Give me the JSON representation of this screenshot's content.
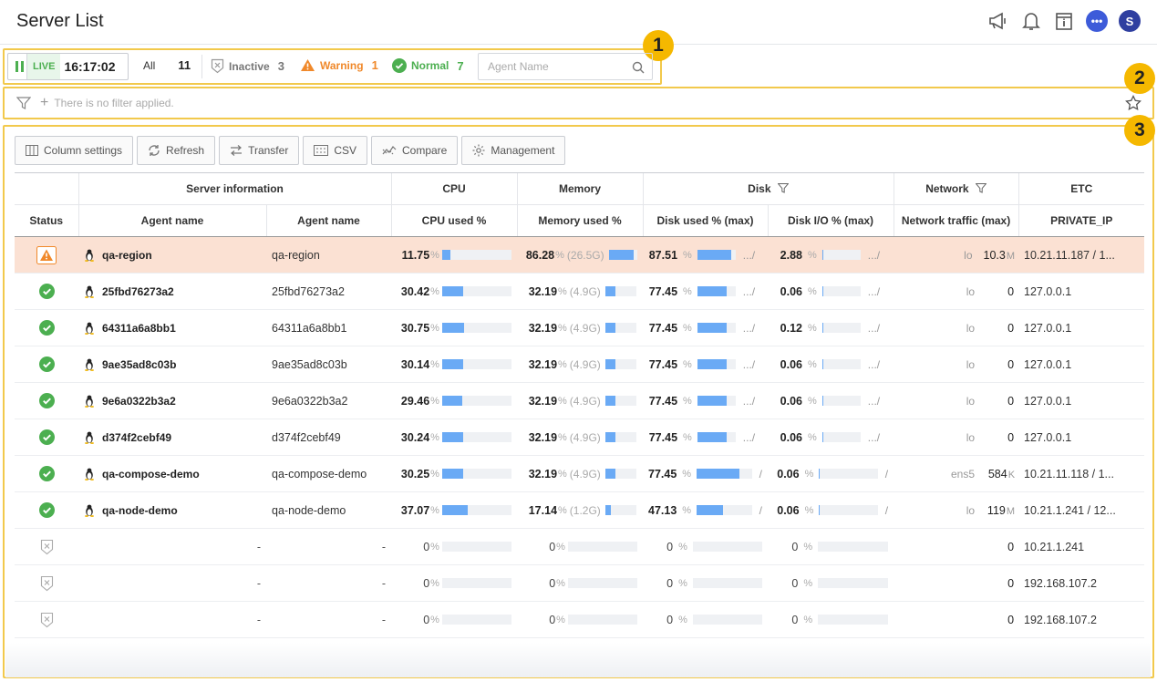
{
  "header": {
    "title": "Server List",
    "icons": [
      "megaphone-icon",
      "bell-icon",
      "document-info-icon",
      "chat-icon",
      "avatar"
    ],
    "avatar_letter": "S",
    "chat_glyph": "•••"
  },
  "badges": [
    "1",
    "2",
    "3"
  ],
  "status_bar": {
    "live_label": "LIVE",
    "time": "16:17:02",
    "all_label": "All",
    "all_count": "11",
    "inactive_label": "Inactive",
    "inactive_count": "3",
    "warning_label": "Warning",
    "warning_count": "1",
    "normal_label": "Normal",
    "normal_count": "7",
    "search_placeholder": "Agent Name"
  },
  "filter": {
    "text": "There is no filter applied."
  },
  "toolbar": {
    "column_settings": "Column settings",
    "refresh": "Refresh",
    "transfer": "Transfer",
    "csv": "CSV",
    "compare": "Compare",
    "management": "Management"
  },
  "table": {
    "groups": [
      "Server information",
      "CPU",
      "Memory",
      "Disk",
      "Network",
      "ETC"
    ],
    "columns": [
      "Status",
      "Agent name",
      "Agent name",
      "CPU used %",
      "Memory used %",
      "Disk used % (max)",
      "Disk I/O % (max)",
      "Network traffic (max)",
      "PRIVATE_IP"
    ],
    "pct": "%",
    "ellipsis": ".../",
    "slash": "/",
    "dash": "-",
    "rows": [
      {
        "status": "warning",
        "name": "qa-region",
        "name2": "qa-region",
        "cpu": "11.75",
        "cpu_fill": 0.12,
        "mem": "86.28",
        "mem_size": "(26.5G)",
        "mem_fill": 0.86,
        "disk": "87.51",
        "disk_fill": 0.88,
        "disk_tail": ".../",
        "io": "2.88",
        "io_fill": 0.03,
        "io_tail": ".../",
        "iface": "lo",
        "net": "10.3",
        "net_unit": "M",
        "ip": "10.21.11.187 / 1..."
      },
      {
        "status": "normal",
        "name": "25fbd76273a2",
        "name2": "25fbd76273a2",
        "cpu": "30.42",
        "cpu_fill": 0.3,
        "mem": "32.19",
        "mem_size": "(4.9G)",
        "mem_fill": 0.32,
        "disk": "77.45",
        "disk_fill": 0.77,
        "disk_tail": ".../",
        "io": "0.06",
        "io_fill": 0.0,
        "io_tail": ".../",
        "iface": "lo",
        "net": "0",
        "net_unit": "",
        "ip": "127.0.0.1"
      },
      {
        "status": "normal",
        "name": "64311a6a8bb1",
        "name2": "64311a6a8bb1",
        "cpu": "30.75",
        "cpu_fill": 0.31,
        "mem": "32.19",
        "mem_size": "(4.9G)",
        "mem_fill": 0.32,
        "disk": "77.45",
        "disk_fill": 0.77,
        "disk_tail": ".../",
        "io": "0.12",
        "io_fill": 0.01,
        "io_tail": ".../",
        "iface": "lo",
        "net": "0",
        "net_unit": "",
        "ip": "127.0.0.1"
      },
      {
        "status": "normal",
        "name": "9ae35ad8c03b",
        "name2": "9ae35ad8c03b",
        "cpu": "30.14",
        "cpu_fill": 0.3,
        "mem": "32.19",
        "mem_size": "(4.9G)",
        "mem_fill": 0.32,
        "disk": "77.45",
        "disk_fill": 0.77,
        "disk_tail": ".../",
        "io": "0.06",
        "io_fill": 0.0,
        "io_tail": ".../",
        "iface": "lo",
        "net": "0",
        "net_unit": "",
        "ip": "127.0.0.1"
      },
      {
        "status": "normal",
        "name": "9e6a0322b3a2",
        "name2": "9e6a0322b3a2",
        "cpu": "29.46",
        "cpu_fill": 0.29,
        "mem": "32.19",
        "mem_size": "(4.9G)",
        "mem_fill": 0.32,
        "disk": "77.45",
        "disk_fill": 0.77,
        "disk_tail": ".../",
        "io": "0.06",
        "io_fill": 0.0,
        "io_tail": ".../",
        "iface": "lo",
        "net": "0",
        "net_unit": "",
        "ip": "127.0.0.1"
      },
      {
        "status": "normal",
        "name": "d374f2cebf49",
        "name2": "d374f2cebf49",
        "cpu": "30.24",
        "cpu_fill": 0.3,
        "mem": "32.19",
        "mem_size": "(4.9G)",
        "mem_fill": 0.32,
        "disk": "77.45",
        "disk_fill": 0.77,
        "disk_tail": ".../",
        "io": "0.06",
        "io_fill": 0.0,
        "io_tail": ".../",
        "iface": "lo",
        "net": "0",
        "net_unit": "",
        "ip": "127.0.0.1"
      },
      {
        "status": "normal",
        "name": "qa-compose-demo",
        "name2": "qa-compose-demo",
        "cpu": "30.25",
        "cpu_fill": 0.3,
        "mem": "32.19",
        "mem_size": "(4.9G)",
        "mem_fill": 0.32,
        "disk": "77.45",
        "disk_fill": 0.77,
        "disk_tail": "/",
        "io": "0.06",
        "io_fill": 0.0,
        "io_tail": "/",
        "iface": "ens5",
        "net": "584",
        "net_unit": "K",
        "ip": "10.21.11.118 / 1..."
      },
      {
        "status": "normal",
        "name": "qa-node-demo",
        "name2": "qa-node-demo",
        "cpu": "37.07",
        "cpu_fill": 0.37,
        "mem": "17.14",
        "mem_size": "(1.2G)",
        "mem_fill": 0.17,
        "disk": "47.13",
        "disk_fill": 0.47,
        "disk_tail": "/",
        "io": "0.06",
        "io_fill": 0.0,
        "io_tail": "/",
        "iface": "lo",
        "net": "119",
        "net_unit": "M",
        "ip": "10.21.1.241 / 12..."
      },
      {
        "status": "inactive",
        "name": "-",
        "name2": "-",
        "cpu": "0",
        "cpu_fill": 0,
        "mem": "0",
        "mem_size": "",
        "mem_fill": 0,
        "disk": "0",
        "disk_fill": 0,
        "disk_tail": "",
        "io": "0",
        "io_fill": 0,
        "io_tail": "",
        "iface": "",
        "net": "0",
        "net_unit": "",
        "ip": "10.21.1.241"
      },
      {
        "status": "inactive",
        "name": "-",
        "name2": "-",
        "cpu": "0",
        "cpu_fill": 0,
        "mem": "0",
        "mem_size": "",
        "mem_fill": 0,
        "disk": "0",
        "disk_fill": 0,
        "disk_tail": "",
        "io": "0",
        "io_fill": 0,
        "io_tail": "",
        "iface": "",
        "net": "0",
        "net_unit": "",
        "ip": "192.168.107.2"
      },
      {
        "status": "inactive",
        "name": "-",
        "name2": "-",
        "cpu": "0",
        "cpu_fill": 0,
        "mem": "0",
        "mem_size": "",
        "mem_fill": 0,
        "disk": "0",
        "disk_fill": 0,
        "disk_tail": "",
        "io": "0",
        "io_fill": 0,
        "io_tail": "",
        "iface": "",
        "net": "0",
        "net_unit": "",
        "ip": "192.168.107.2"
      }
    ]
  },
  "colors": {
    "highlight": "#f2c94c",
    "badge": "#f5b800",
    "normal": "#4caf50",
    "warning": "#f0892b",
    "bar": "#6aaaf5",
    "warn_row": "#fbe1d3"
  }
}
